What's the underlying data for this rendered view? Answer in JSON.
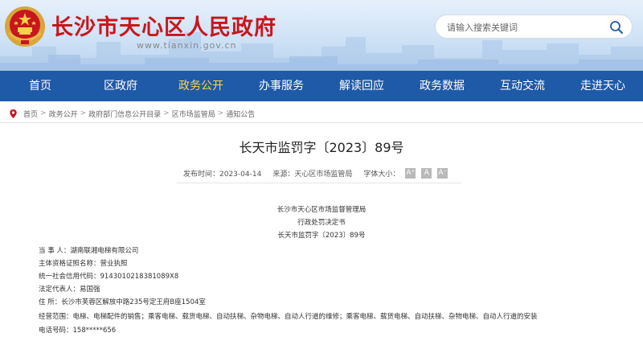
{
  "header": {
    "site_title": "长沙市天心区人民政府",
    "site_domain": "www.tianxin.gov.cn",
    "search_placeholder": "请输入搜索关键词"
  },
  "nav": {
    "items": [
      "首页",
      "区政府",
      "政务公开",
      "办事服务",
      "解读回应",
      "政务数据",
      "互动交流",
      "走进天心"
    ],
    "active_index": 2,
    "active_color": "#ffd34d",
    "bar_color": "#1f5aa8"
  },
  "breadcrumb": [
    "首页",
    "政务公开",
    "政府部门信息公开目录",
    "区市场监管局",
    "通知公告"
  ],
  "breadcrumb_separator": ">",
  "article": {
    "title": "长天市监罚字〔2023〕89号",
    "publish_label": "发布时间：2023-04-14",
    "source_label": "来源：天心区市场监管局",
    "font_size_label": "字体大小：",
    "font_buttons": [
      "A⁺",
      "A",
      "A⁻"
    ],
    "heading_lines": [
      "长沙市天心区市场监督管理局",
      "行政处罚决定书",
      "长天市监罚字〔2023〕89号"
    ],
    "body_lines": [
      "当 事 人：湖南联湘电梯有限公司",
      "主体资格证照名称：营业执照",
      "统一社会信用代码：914301021838​1089X8",
      "法定代表人：易国强",
      "住 所：长沙市芙蓉区解放中路235号定王府B座1504室",
      "经营范围：电梯、电梯配件的销售；乘客电梯、载货电梯、自动扶梯、杂物电梯、自动人行道的维修；乘客电梯、载货电梯、自动扶梯、杂物电梯、自动人行道的安装",
      "电话号码：158*****656"
    ]
  }
}
